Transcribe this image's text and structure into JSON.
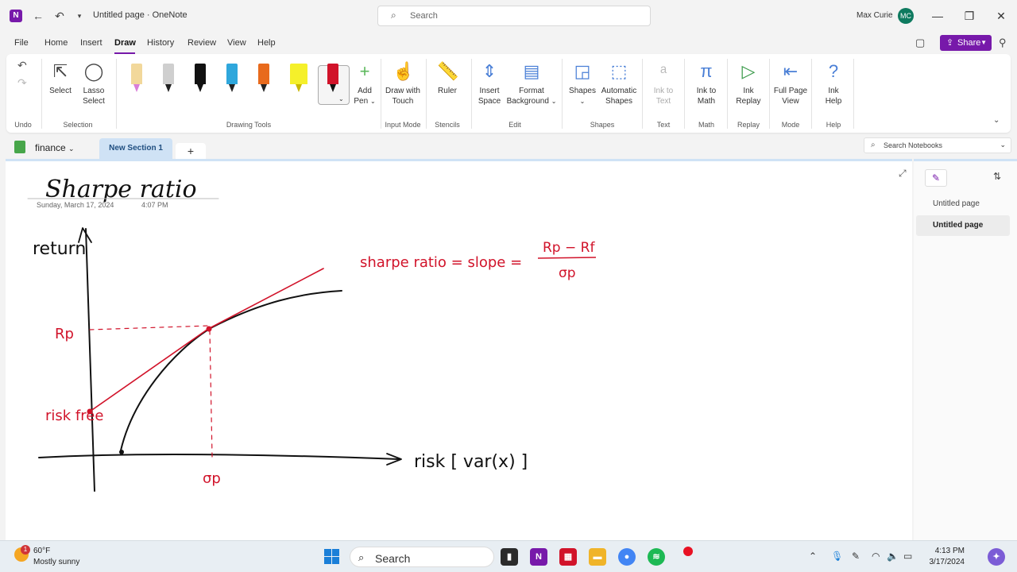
{
  "titlebar": {
    "app_icon": "N",
    "doc_title": "Untitled page",
    "app_name": "OneNote",
    "title_text": "Untitled page  ·  OneNote",
    "search_placeholder": "Search",
    "user_name": "Max Curie",
    "user_initials": "MC"
  },
  "menu": {
    "items": [
      "File",
      "Home",
      "Insert",
      "Draw",
      "History",
      "Review",
      "View",
      "Help"
    ],
    "active": "Draw",
    "share_label": "Share"
  },
  "ribbon": {
    "undo_group_label": "Undo",
    "select_label": "Select",
    "lasso_label": "Lasso",
    "lasso_label2": "Select",
    "selection_group_label": "Selection",
    "add_pen_label": "Add",
    "add_pen_label2": "Pen",
    "drawing_tools_label": "Drawing Tools",
    "draw_touch_label": "Draw with",
    "draw_touch_label2": "Touch",
    "input_mode_label": "Input Mode",
    "ruler_label": "Ruler",
    "stencils_label": "Stencils",
    "insert_space_label": "Insert",
    "insert_space_label2": "Space",
    "format_bg_label": "Format",
    "format_bg_label2": "Background",
    "edit_label": "Edit",
    "shapes_label": "Shapes",
    "auto_shapes_label": "Automatic",
    "auto_shapes_label2": "Shapes",
    "shapes_group_label": "Shapes",
    "ink_text_label": "Ink to",
    "ink_text_label2": "Text",
    "text_group_label": "Text",
    "ink_math_label": "Ink to",
    "ink_math_label2": "Math",
    "math_group_label": "Math",
    "ink_replay_label": "Ink",
    "ink_replay_label2": "Replay",
    "replay_group_label": "Replay",
    "full_page_label": "Full Page",
    "full_page_label2": "View",
    "mode_group_label": "Mode",
    "ink_help_label": "Ink",
    "ink_help_label2": "Help",
    "help_group_label": "Help",
    "pens": [
      {
        "color": "#f2d89b",
        "secondary": "#d97ed9"
      },
      {
        "color": "#cfcfcf",
        "secondary": "#222222"
      },
      {
        "color": "#111111",
        "secondary": "#111111"
      },
      {
        "color": "#2fa7dc",
        "secondary": "#2fa7dc"
      },
      {
        "color": "#e86a1c",
        "secondary": "#e86a1c"
      },
      {
        "color": "#f5f02a",
        "secondary": "#f5f02a"
      },
      {
        "color": "#d1132a",
        "secondary": "#d1132a"
      }
    ]
  },
  "notebook": {
    "name": "finance",
    "section": "New Section 1",
    "add_section": "+",
    "search_placeholder": "Search Notebooks"
  },
  "page": {
    "title_ink": "Sharpe ratio",
    "date": "Sunday, March 17, 2024",
    "time": "4:07 PM",
    "ink_labels": {
      "y_axis": "return",
      "x_axis": "risk [ var(x) ]",
      "rp": "Rp",
      "risk_free": "risk free",
      "sigma_p": "σp",
      "formula": "sharpe ratio = slope =",
      "numerator": "Rp − Rf",
      "denominator": "σp"
    },
    "colors": {
      "ink_black": "#111111",
      "ink_red": "#d1132a"
    }
  },
  "page_list": {
    "pages": [
      {
        "title": "Untitled page",
        "selected": false
      },
      {
        "title": "Untitled page",
        "selected": true
      }
    ]
  },
  "taskbar": {
    "weather_badge": "1",
    "weather_temp": "60°F",
    "weather_desc": "Mostly sunny",
    "search_label": "Search",
    "time": "4:13 PM",
    "date": "3/17/2024"
  }
}
